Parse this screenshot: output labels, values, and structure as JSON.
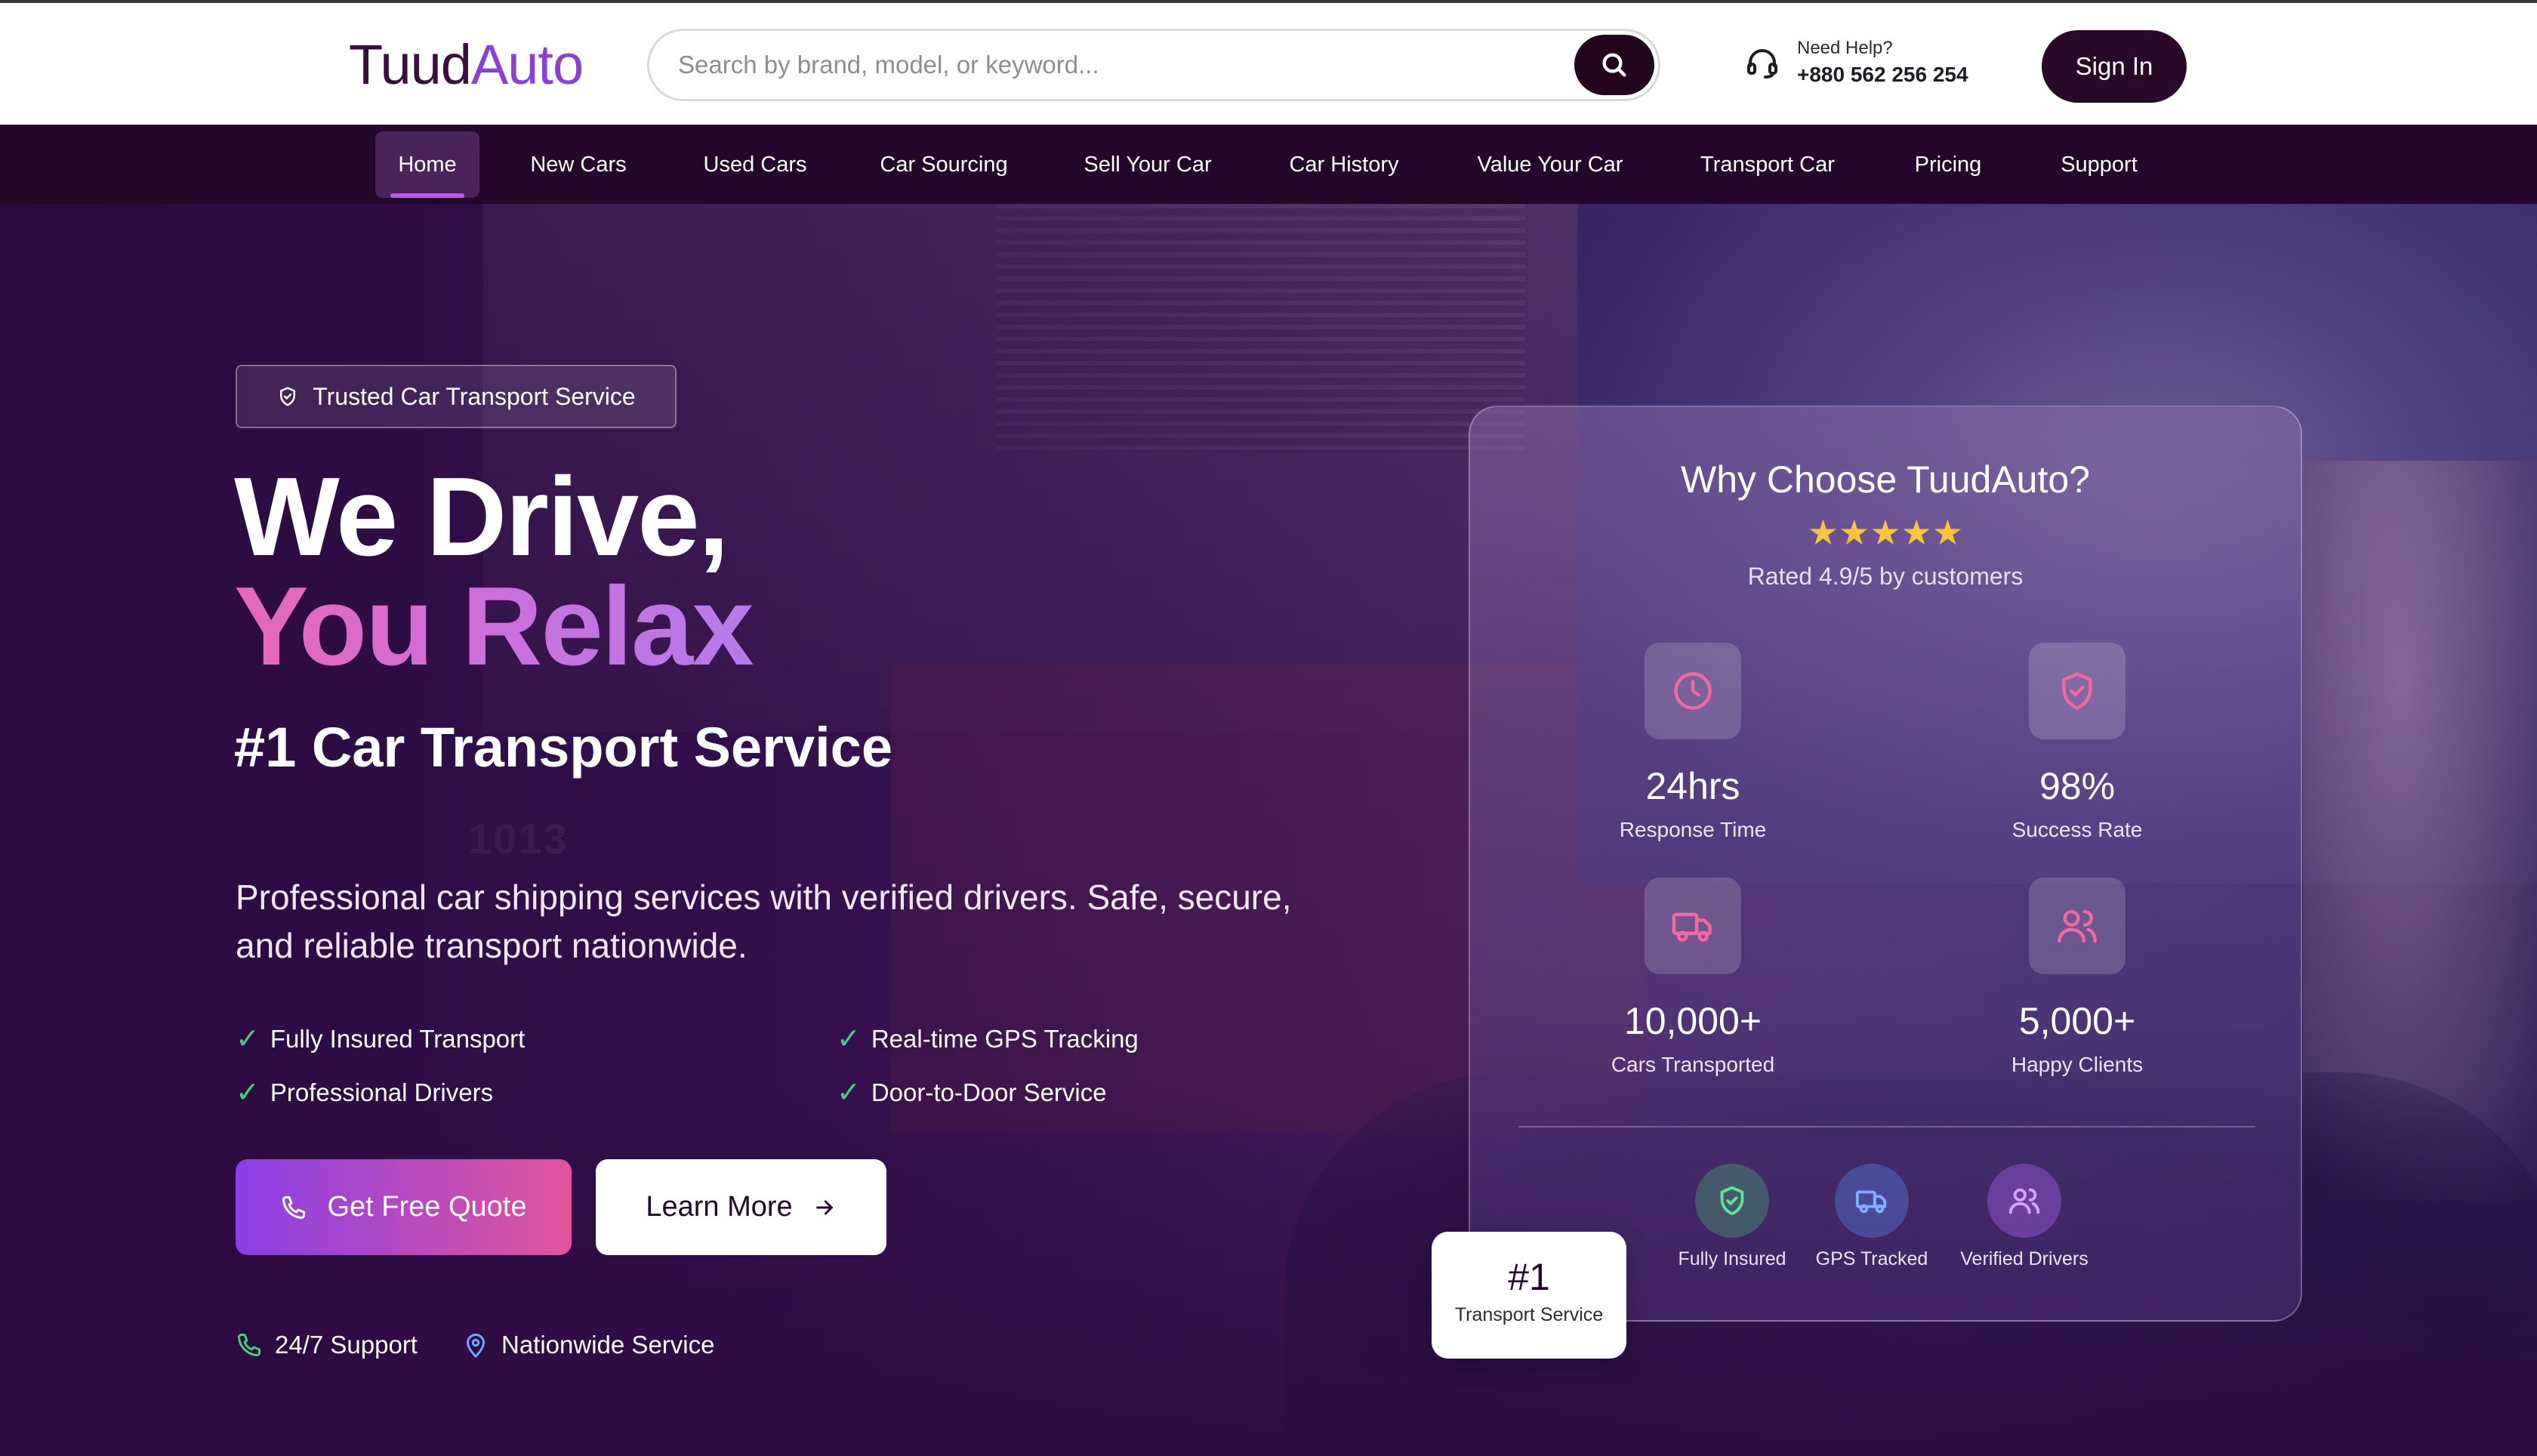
{
  "header": {
    "logo_part1": "Tuud",
    "logo_part2": "Auto",
    "search_placeholder": "Search by brand, model, or keyword...",
    "help_label": "Need Help?",
    "help_phone": "+880 562 256 254",
    "signin_label": "Sign In"
  },
  "nav": {
    "items": [
      "Home",
      "New Cars",
      "Used Cars",
      "Car Sourcing",
      "Sell Your Car",
      "Car History",
      "Value Your Car",
      "Transport Car",
      "Pricing",
      "Support"
    ],
    "active": "Home"
  },
  "hero": {
    "badge": "Trusted Car Transport Service",
    "title_line1": "We Drive,",
    "title_line2": "You Relax",
    "subtitle": "#1 Car Transport Service",
    "description": "Professional car shipping services with verified drivers. Safe, secure, and reliable transport nationwide.",
    "features": [
      "Fully Insured Transport",
      "Real-time GPS Tracking",
      "Professional Drivers",
      "Door-to-Door Service"
    ],
    "primary_button": "Get Free Quote",
    "secondary_button": "Learn More",
    "footer_items": [
      "24/7 Support",
      "Nationwide Service"
    ],
    "background_text": "1013"
  },
  "card": {
    "title": "Why Choose TuudAuto?",
    "stars": "★★★★★",
    "rating_text": "Rated 4.9/5 by customers",
    "stats": [
      {
        "value": "24hrs",
        "label": "Response Time",
        "icon": "clock-icon"
      },
      {
        "value": "98%",
        "label": "Success Rate",
        "icon": "shield-check-icon"
      },
      {
        "value": "10,000+",
        "label": "Cars Transported",
        "icon": "truck-icon"
      },
      {
        "value": "5,000+",
        "label": "Happy Clients",
        "icon": "users-icon"
      }
    ],
    "badges": [
      "Fully Insured",
      "GPS Tracked",
      "Verified Drivers"
    ],
    "rank_number": "#1",
    "rank_label": "Transport Service"
  },
  "colors": {
    "brand_dark": "#24082b",
    "brand_purple": "#8b3fd9",
    "accent_pink": "#e0559c",
    "check_green": "#45d17b",
    "star_yellow": "#f7c43b"
  }
}
